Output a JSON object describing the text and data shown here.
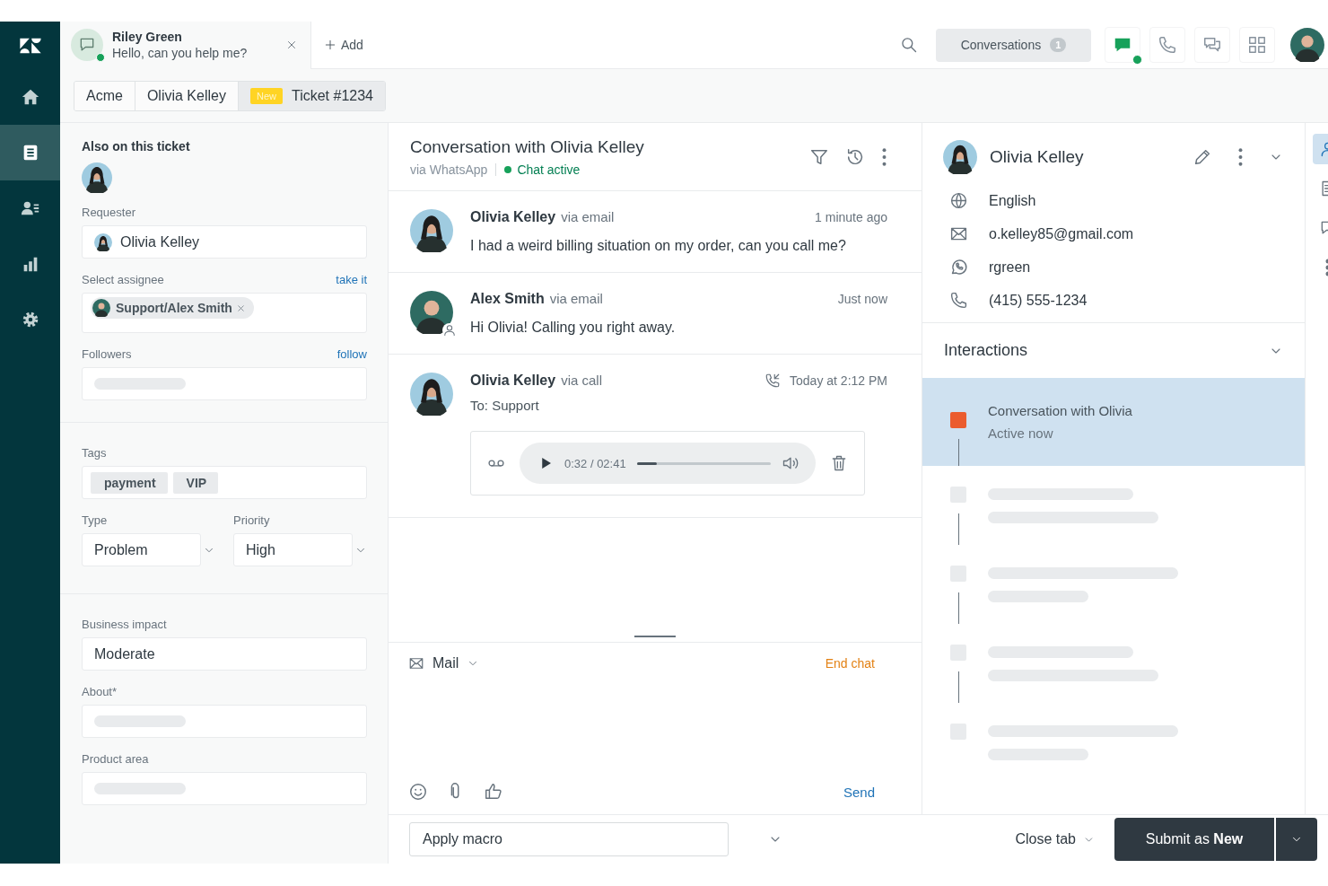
{
  "nav": {
    "items": [
      {
        "kind": "home",
        "selected": false
      },
      {
        "kind": "tickets",
        "selected": true
      },
      {
        "kind": "users",
        "selected": false
      },
      {
        "kind": "reports",
        "selected": false
      },
      {
        "kind": "settings",
        "selected": false
      }
    ]
  },
  "top_bar": {
    "session": {
      "name": "Riley Green",
      "message": "Hello, can you help me?",
      "online": true
    },
    "add": "Add",
    "conversations": {
      "label": "Conversations",
      "count": "1"
    },
    "apps": [
      {
        "kind": "chat",
        "selected": true,
        "online": true
      },
      {
        "kind": "phone",
        "selected": false,
        "online": false
      },
      {
        "kind": "chats",
        "selected": false,
        "online": false
      },
      {
        "kind": "grid",
        "selected": false,
        "online": false
      }
    ]
  },
  "tabs": [
    {
      "label": "Acme",
      "selected": false
    },
    {
      "label": "Olivia Kelley",
      "selected": false
    },
    {
      "label": "Ticket #1234",
      "badge": "New",
      "selected": true
    }
  ],
  "ticket_fields": {
    "title": "Also on this ticket",
    "sections": [
      {
        "fields": [
          {
            "kind": "user",
            "label": "Requester",
            "value": "Olivia Kelley"
          },
          {
            "kind": "chips",
            "label": "Select assignee",
            "action": "take it",
            "chips": [
              {
                "label": "Support/Alex Smith",
                "removable": true,
                "avatar": true
              }
            ]
          },
          {
            "kind": "skeleton",
            "label": "Followers",
            "action": "follow"
          }
        ]
      },
      {
        "fields": [
          {
            "kind": "chips",
            "label": "Tags",
            "chips": [
              {
                "label": "payment",
                "removable": false,
                "avatar": false
              },
              {
                "label": "VIP",
                "removable": false,
                "avatar": false
              }
            ]
          },
          {
            "kind": "row",
            "fields": [
              {
                "kind": "select",
                "label": "Type",
                "value": "Problem"
              },
              {
                "kind": "select",
                "label": "Priority",
                "value": "High"
              }
            ]
          }
        ]
      },
      {
        "fields": [
          {
            "kind": "text",
            "label": "Business impact",
            "value": "Moderate"
          },
          {
            "kind": "skeleton",
            "label": "About*"
          },
          {
            "kind": "skeleton",
            "label": "Product area"
          }
        ]
      }
    ]
  },
  "conversation": {
    "title": "Conversation with Olivia Kelley",
    "channel": "via WhatsApp",
    "status": "Chat active",
    "active": true,
    "messages": [
      {
        "kind": "message",
        "author": "Olivia Kelley",
        "via": "via email",
        "time": "1 minute ago",
        "body": "I had a weird billing situation on my order, can you call me?",
        "agent": false
      },
      {
        "kind": "message",
        "author": "Alex Smith",
        "via": "via email",
        "time": "Just now",
        "body": "Hi Olivia! Calling you right away.",
        "agent": true
      },
      {
        "kind": "call",
        "author": "Olivia Kelley",
        "via": "via call",
        "time": "Today at 2:12 PM",
        "body": "To: Support",
        "agent": false,
        "audio": {
          "time": "0:32 / 02:41",
          "level": 0.15
        }
      }
    ],
    "composer": {
      "channel": "Mail",
      "end": "End chat",
      "send": "Send"
    }
  },
  "customer": {
    "name": "Olivia Kelley",
    "details": [
      {
        "kind": "language",
        "value": "English"
      },
      {
        "kind": "email",
        "value": "o.kelley85@gmail.com"
      },
      {
        "kind": "whatsapp",
        "value": "rgreen"
      },
      {
        "kind": "phone",
        "value": "(415) 555-1234"
      }
    ]
  },
  "interactions": {
    "title": "Interactions",
    "items": [
      {
        "kind": "conversation",
        "title": "Conversation with Olivia",
        "subtitle": "Active now",
        "selected": true
      },
      {
        "kind": "skeleton",
        "selected": false
      },
      {
        "kind": "skeleton",
        "selected": false
      },
      {
        "kind": "skeleton",
        "selected": false
      },
      {
        "kind": "skeleton",
        "selected": false
      }
    ]
  },
  "rail": [
    {
      "kind": "user",
      "selected": true
    },
    {
      "kind": "doc",
      "selected": false
    },
    {
      "kind": "chat",
      "selected": false
    },
    {
      "kind": "apps",
      "selected": false
    }
  ],
  "footer": {
    "macro_placeholder": "Apply macro",
    "close": "Close tab",
    "submit": "Submit as **New**"
  }
}
